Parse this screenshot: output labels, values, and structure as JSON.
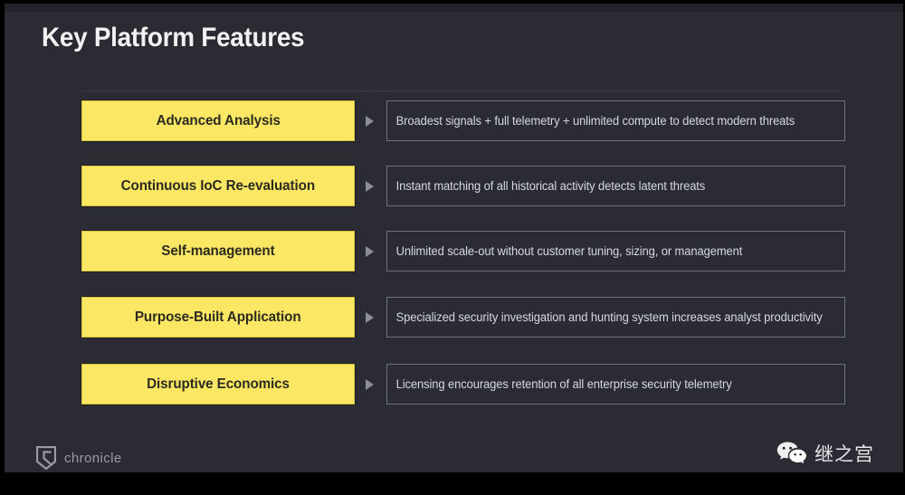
{
  "slide": {
    "title": "Key Platform Features",
    "background_color": "#2a2b33",
    "accent_color": "#fbe764",
    "border_color": "#6e7180"
  },
  "features": [
    {
      "name": "Advanced Analysis",
      "description": "Broadest signals + full telemetry + unlimited compute to detect modern threats"
    },
    {
      "name": "Continuous IoC Re-evaluation",
      "description": "Instant matching of all historical activity detects latent threats"
    },
    {
      "name": "Self-management",
      "description": "Unlimited scale-out without customer tuning, sizing, or management"
    },
    {
      "name": "Purpose-Built Application",
      "description": "Specialized security investigation and hunting system increases analyst productivity"
    },
    {
      "name": "Disruptive Economics",
      "description": "Licensing encourages retention of all enterprise security telemetry"
    }
  ],
  "branding": {
    "logo_icon": "chronicle-shield-icon",
    "name": "chronicle"
  },
  "watermark": {
    "icon": "wechat-icon",
    "text": "继之宫"
  }
}
